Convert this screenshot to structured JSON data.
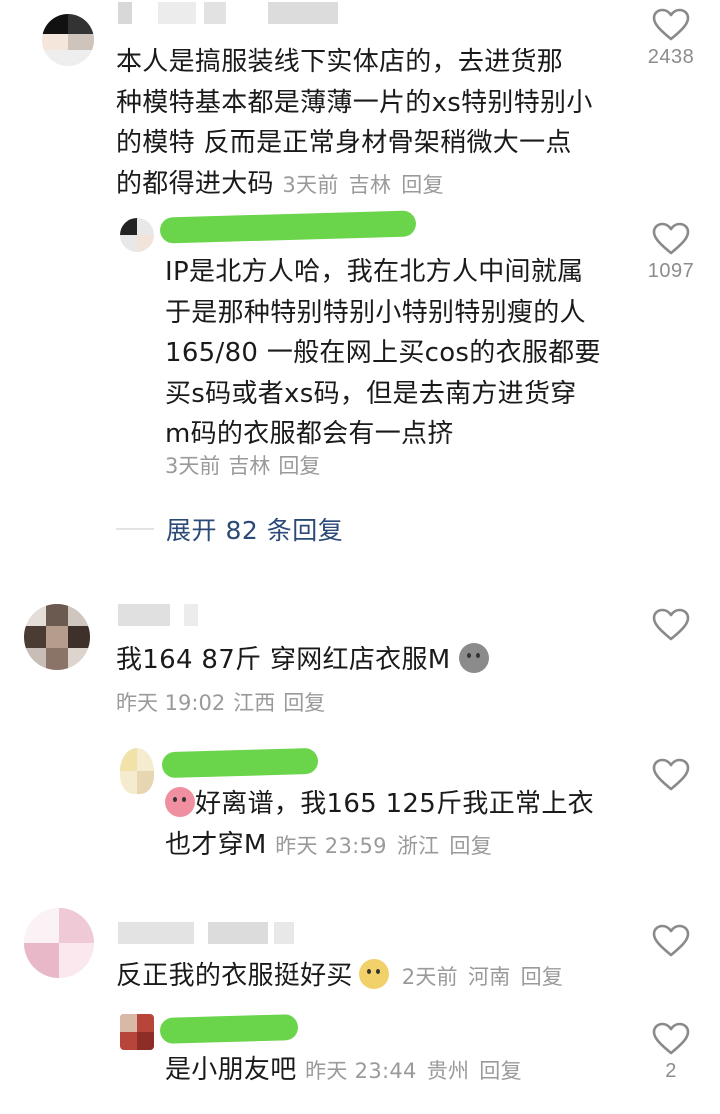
{
  "comments": [
    {
      "text_lines": [
        "本人是搞服装线下实体店的，去进货那",
        "种模特基本都是薄薄一片的xs特别特别小",
        "的模特 反而是正常身材骨架稍微大一点",
        "的都得进大码"
      ],
      "time": "3天前",
      "location": "吉林",
      "reply_label": "回复",
      "likes": "2438",
      "reply": {
        "text_lines": [
          "IP是北方人哈，我在北方人中间就属",
          "于是那种特别特别小特别特别瘦的人",
          "165/80 一般在网上买cos的衣服都要",
          "买s码或者xs码，但是去南方进货穿",
          "m码的衣服都会有一点挤"
        ],
        "time": "3天前",
        "location": "吉林",
        "reply_label": "回复",
        "likes": "1097"
      },
      "expand_label": "展开 82 条回复"
    },
    {
      "text": "我164 87斤 穿网红店衣服M",
      "emoji": "grey-emoji",
      "time": "昨天 19:02",
      "location": "江西",
      "reply_label": "回复",
      "likes": "",
      "reply": {
        "text_line1": "好离谱，我165 125斤我正常上衣",
        "text_line2": "也才穿M",
        "emoji": "crying-emoji",
        "time": "昨天 23:59",
        "location": "浙江",
        "reply_label": "回复",
        "likes": ""
      }
    },
    {
      "text": "反正我的衣服挺好买",
      "emoji": "dog-emoji",
      "time": "2天前",
      "location": "河南",
      "reply_label": "回复",
      "likes": "",
      "reply": {
        "text": "是小朋友吧",
        "time": "昨天 23:44",
        "location": "贵州",
        "reply_label": "回复",
        "likes": "2"
      }
    }
  ],
  "colors": {
    "text": "#1a1a1a",
    "meta": "#9a9a9a",
    "expand": "#2b4a78",
    "scribble": "#62d240",
    "heart": "#8a8a8a"
  }
}
